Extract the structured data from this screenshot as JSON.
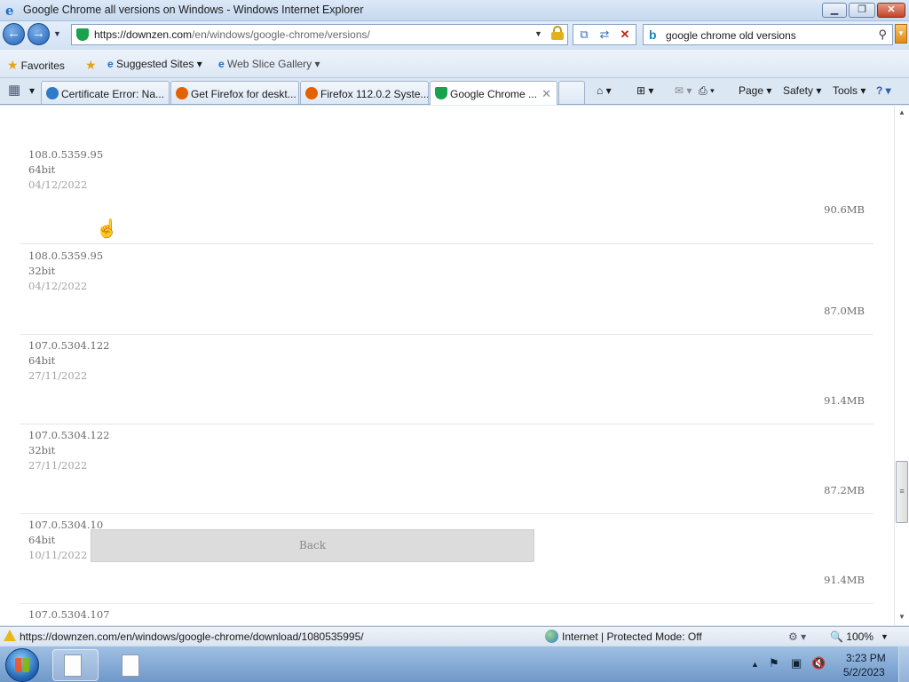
{
  "window": {
    "title": "Google Chrome all versions on Windows - Windows Internet Explorer",
    "minimize": "▁",
    "maximize": "❐",
    "close": "✕"
  },
  "nav": {
    "back": "←",
    "forward": "→",
    "dropdown": "▼",
    "url_host": "https://downzen.com",
    "url_path": "/en/windows/google-chrome/versions/",
    "url_dropdown": "▼",
    "compat": "⧉",
    "refresh": "⇄",
    "stop": "✕"
  },
  "search": {
    "logo": "b",
    "value": "google chrome old versions",
    "icon": "⚲",
    "dropdown": "▼"
  },
  "favorites": {
    "label": "Favorites",
    "items": [
      "Suggested Sites ▾",
      "Web Slice Gallery ▾"
    ]
  },
  "tabs": [
    {
      "label": "Certificate Error: Na...",
      "icon_color": "#2f7bc7"
    },
    {
      "label": "Get Firefox for deskt...",
      "icon_color": "#e66000"
    },
    {
      "label": "Firefox 112.0.2 Syste...",
      "icon_color": "#e66000"
    },
    {
      "label": "Google Chrome ...",
      "icon_color": "#17a24b",
      "close": "✕"
    }
  ],
  "tabgroup": {
    "icon": "▦",
    "dropdown": "▾"
  },
  "commands": {
    "home": "⌂ ▾",
    "feeds": "⊞ ▾",
    "mail": "✉ ▾",
    "print": "⎙ ▾",
    "page": "Page ▾",
    "safety": "Safety ▾",
    "tools": "Tools ▾",
    "help": "? ▾"
  },
  "versions": [
    {
      "version": "108.0.5359.95",
      "arch": "64bit",
      "date": "04/12/2022",
      "size": "90.6MB"
    },
    {
      "version": "108.0.5359.95",
      "arch": "32bit",
      "date": "04/12/2022",
      "size": "87.0MB"
    },
    {
      "version": "107.0.5304.122",
      "arch": "64bit",
      "date": "27/11/2022",
      "size": "91.4MB"
    },
    {
      "version": "107.0.5304.122",
      "arch": "32bit",
      "date": "27/11/2022",
      "size": "87.2MB"
    },
    {
      "version": "107.0.5304.10",
      "arch": "64bit",
      "date": "10/11/2022",
      "size": "91.4MB"
    },
    {
      "version": "107.0.5304.107",
      "arch": "",
      "date": "",
      "size": ""
    }
  ],
  "back_button": "Back",
  "scrollbar": {
    "up": "▲",
    "down": "▼",
    "grip": "≡"
  },
  "status": {
    "url": "https://downzen.com/en/windows/google-chrome/download/1080535995/",
    "zone": "Internet | Protected Mode: Off",
    "zoom": "🔍 100%",
    "zoom_dropdown": "▼",
    "protect": "⚙ ▾"
  },
  "taskbar": {
    "time": "3:23 PM",
    "date": "5/2/2023",
    "tray_up": "▲",
    "tray_flag": "⚑",
    "tray_net": "▣",
    "tray_vol": "🔇"
  }
}
